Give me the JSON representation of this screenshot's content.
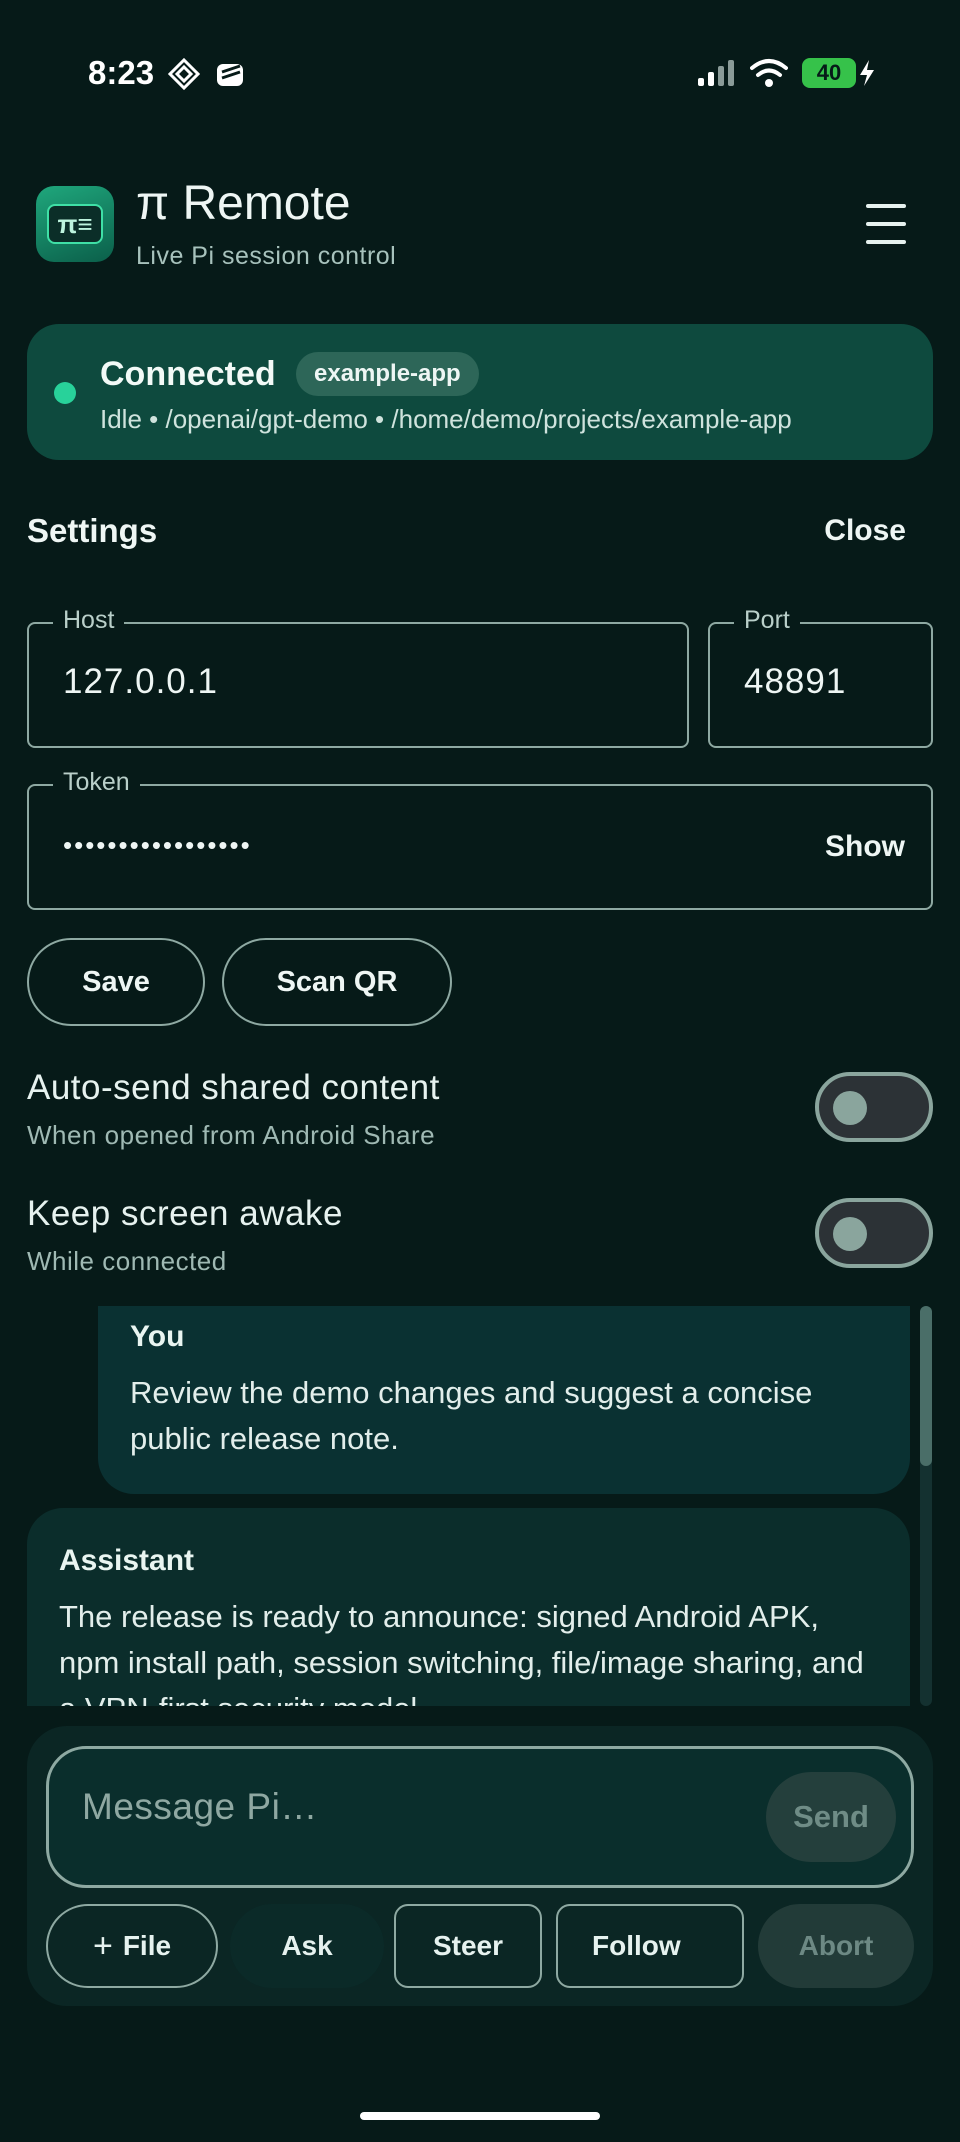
{
  "status_bar": {
    "time": "8:23",
    "battery": "40"
  },
  "header": {
    "title": "π Remote",
    "subtitle": "Live Pi session control",
    "icon_text": "π≡"
  },
  "connection": {
    "state": "Connected",
    "badge": "example-app",
    "details": "Idle • /openai/gpt-demo • /home/demo/projects/example-app",
    "status_color": "#28d29a"
  },
  "settings": {
    "title": "Settings",
    "close_label": "Close",
    "host": {
      "label": "Host",
      "value": "127.0.0.1"
    },
    "port": {
      "label": "Port",
      "value": "48891"
    },
    "token": {
      "label": "Token",
      "value": "•••••••••••••••••",
      "show_label": "Show"
    },
    "save_label": "Save",
    "scan_label": "Scan QR",
    "options": [
      {
        "title": "Auto-send shared content",
        "subtitle": "When opened from Android Share",
        "enabled": false
      },
      {
        "title": "Keep screen awake",
        "subtitle": "While connected",
        "enabled": false
      }
    ]
  },
  "chat": {
    "messages": [
      {
        "role": "You",
        "text": "Review the demo changes and suggest a concise public release note."
      },
      {
        "role": "Assistant",
        "text": "The release is ready to announce: signed Android APK, npm install path, session switching, file/image sharing, and a VPN-first security model."
      }
    ]
  },
  "composer": {
    "placeholder": "Message Pi…",
    "send_label": "Send",
    "file_label": "File",
    "ask_label": "Ask",
    "steer_label": "Steer",
    "follow_label": "Follow",
    "abort_label": "Abort"
  }
}
